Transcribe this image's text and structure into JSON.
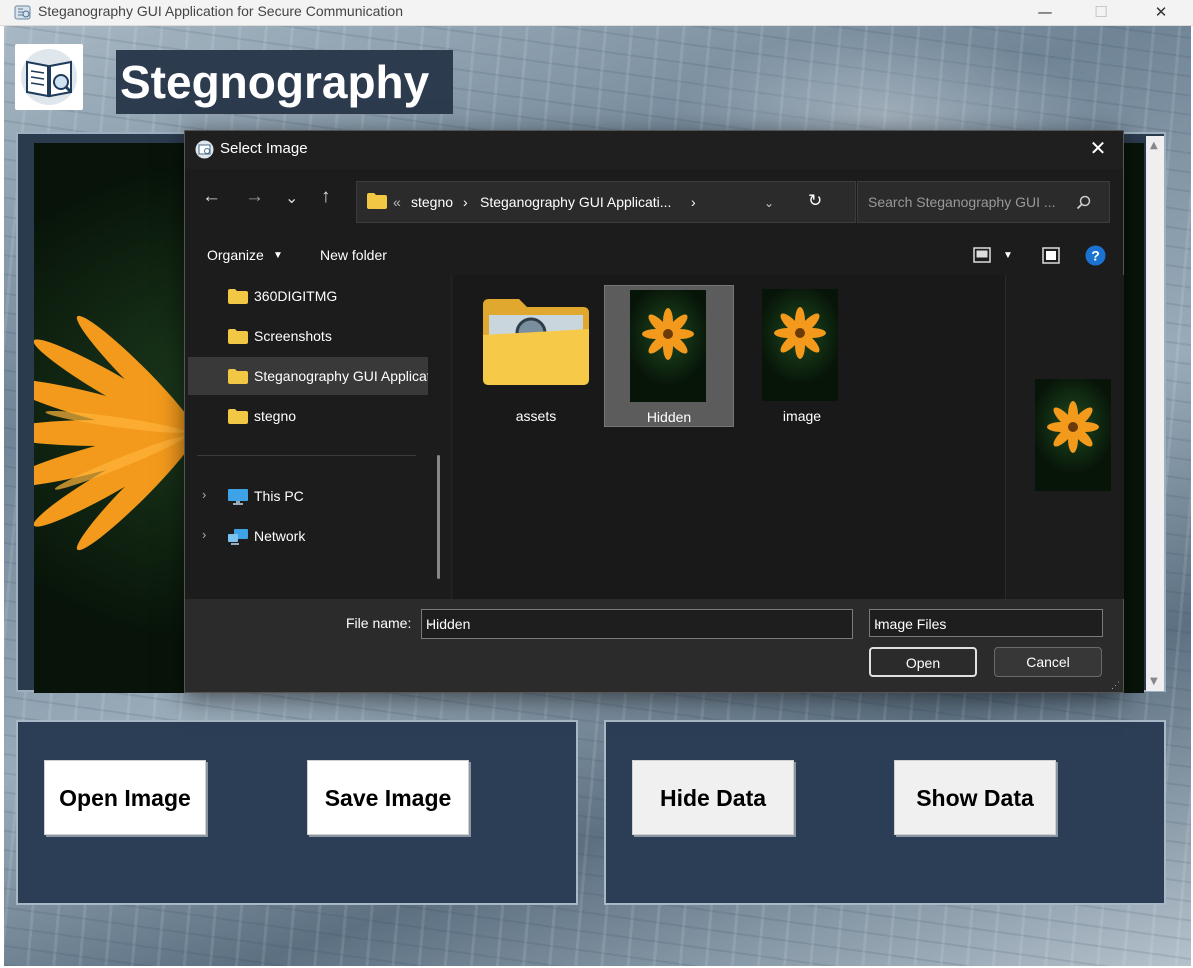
{
  "window": {
    "title": "Steganography GUI Application for Secure Communication",
    "min": "—",
    "max": "☐",
    "close": "✕"
  },
  "app": {
    "heading": "Stegnography",
    "buttons": {
      "open": "Open Image",
      "save": "Save Image",
      "hide": "Hide Data",
      "show": "Show Data"
    }
  },
  "dialog": {
    "title": "Select Image",
    "close": "✕",
    "nav": {
      "back": "←",
      "forward": "→",
      "recent": "⌄",
      "up": "↑",
      "refresh": "↻"
    },
    "breadcrumb": {
      "overflow": "«",
      "items": [
        "stegno",
        "Steganography GUI Applicati..."
      ],
      "sep": "›"
    },
    "search_placeholder": "Search Steganography GUI ...",
    "toolbar": {
      "organize": "Organize",
      "new_folder": "New folder"
    },
    "sidebar": [
      {
        "label": "360DIGITMG"
      },
      {
        "label": "Screenshots"
      },
      {
        "label": "Steganography GUI Application for Secure Communication"
      },
      {
        "label": "stegno"
      },
      {
        "label": "This PC"
      },
      {
        "label": "Network"
      }
    ],
    "files": [
      {
        "name": "assets"
      },
      {
        "name": "Hidden"
      },
      {
        "name": "image"
      }
    ],
    "footer": {
      "file_name_label": "File name:",
      "file_name_value": "Hidden",
      "file_type": "Image Files",
      "open": "Open",
      "cancel": "Cancel"
    }
  },
  "colors": {
    "dialog_bg": "#202020",
    "app_panel": "#2c3e56",
    "selection": "#5c5c5c",
    "folder_yellow": "#f2c744",
    "flower_orange": "#f39a1c"
  }
}
